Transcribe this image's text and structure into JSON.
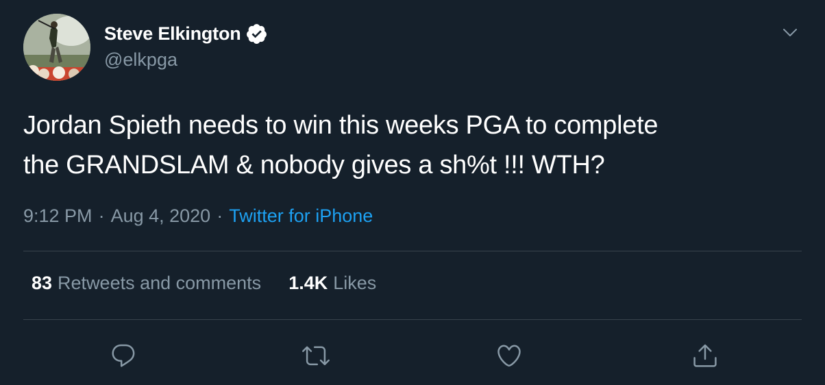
{
  "author": {
    "display_name": "Steve Elkington",
    "handle": "@elkpga",
    "verified": true
  },
  "tweet": {
    "text_line_1": "Jordan Spieth needs to win this weeks PGA to complete",
    "text_line_2": "the GRANDSLAM & nobody gives a sh%t !!! WTH?",
    "time": "9:12 PM",
    "separator": "·",
    "date": "Aug 4, 2020",
    "source": "Twitter for iPhone"
  },
  "stats": {
    "retweets_count": "83",
    "retweets_label": "Retweets and comments",
    "likes_count": "1.4K",
    "likes_label": "Likes"
  },
  "icons": {
    "caret": "chevron-down-icon",
    "verified": "verified-badge-icon",
    "reply": "reply-icon",
    "retweet": "retweet-icon",
    "like": "heart-icon",
    "share": "share-icon"
  },
  "colors": {
    "background": "#15202b",
    "text": "#ffffff",
    "secondary": "#8899a6",
    "link": "#1da1f2",
    "divider": "#38444d"
  }
}
